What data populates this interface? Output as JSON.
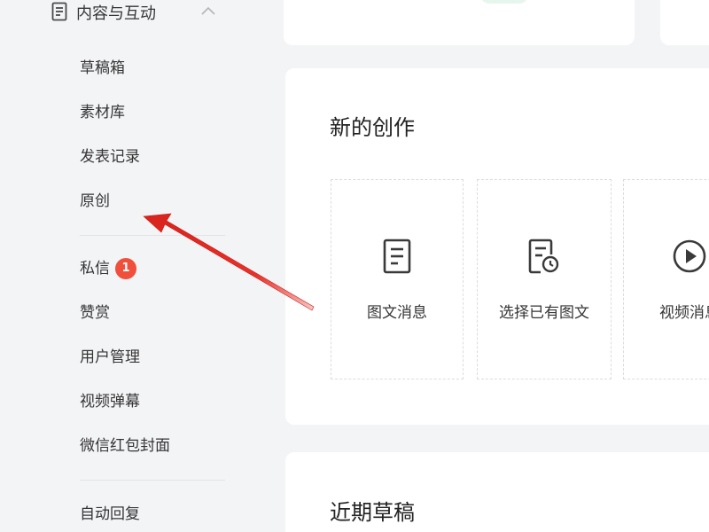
{
  "sidebar": {
    "group": {
      "label": "内容与互动",
      "icon": "document-icon",
      "expand_icon": "chevron-up-icon"
    },
    "items": [
      {
        "label": "草稿箱"
      },
      {
        "label": "素材库"
      },
      {
        "label": "发表记录"
      },
      {
        "label": "原创"
      },
      {
        "label": "私信",
        "badge": "1"
      },
      {
        "label": "赞赏"
      },
      {
        "label": "用户管理"
      },
      {
        "label": "视频弹幕"
      },
      {
        "label": "微信红包封面"
      },
      {
        "label": "自动回复"
      }
    ]
  },
  "main": {
    "create_section": {
      "title": "新的创作",
      "tiles": [
        {
          "label": "图文消息",
          "icon": "document-icon"
        },
        {
          "label": "选择已有图文",
          "icon": "document-clock-icon"
        },
        {
          "label": "视频消息",
          "icon": "play-circle-icon"
        }
      ]
    },
    "drafts_section": {
      "title": "近期草稿"
    }
  },
  "colors": {
    "background": "#f3f4f6",
    "card": "#ffffff",
    "badge": "#f04f3c",
    "annotation_arrow": "#e8312a"
  }
}
